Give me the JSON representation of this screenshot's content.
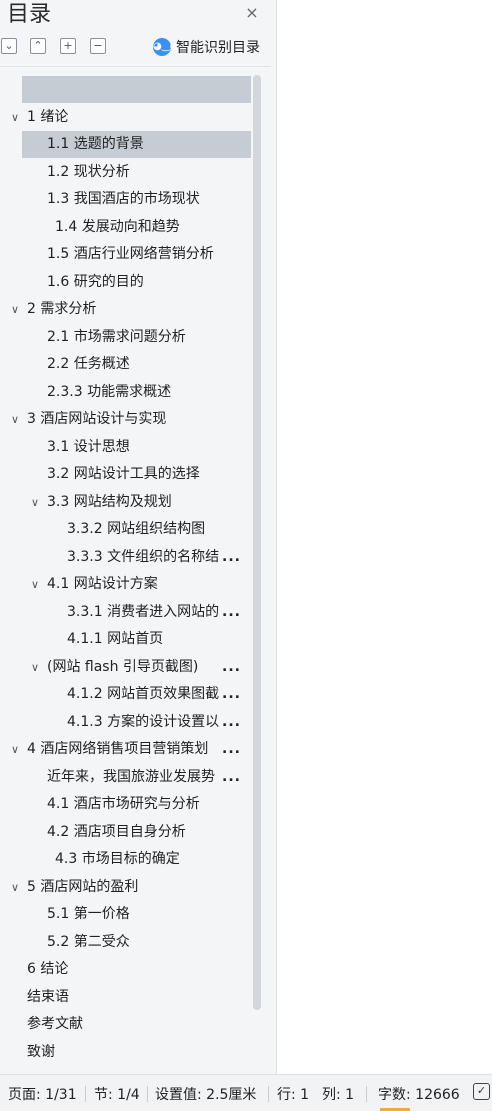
{
  "panel": {
    "title": "目录",
    "close_icon": "×",
    "smart_label": "智能识别目录"
  },
  "toolbar": {
    "collapse_all": "⌄",
    "expand_all": "⌃",
    "add": "+",
    "remove": "−"
  },
  "toc": [
    {
      "label": "",
      "chevron": "",
      "selected": true
    },
    {
      "label": "1  绪论",
      "chevron": "v",
      "selected": false
    },
    {
      "label": "1.1 选题的背景",
      "chevron": "",
      "selected": true
    },
    {
      "label": "1.2 现状分析",
      "chevron": "",
      "selected": false
    },
    {
      "label": "1.3 我国酒店的市场现状",
      "chevron": "",
      "selected": false
    },
    {
      "label": "1.4 发展动向和趋势",
      "chevron": "",
      "selected": false
    },
    {
      "label": "1.5 酒店行业网络营销分析",
      "chevron": "",
      "selected": false
    },
    {
      "label": "1.6 研究的目的",
      "chevron": "",
      "selected": false
    },
    {
      "label": "2  需求分析",
      "chevron": "v",
      "selected": false
    },
    {
      "label": "2.1 市场需求问题分析",
      "chevron": "",
      "selected": false
    },
    {
      "label": "2.2 任务概述",
      "chevron": "",
      "selected": false
    },
    {
      "label": "2.3.3 功能需求概述",
      "chevron": "",
      "selected": false
    },
    {
      "label": "3  酒店网站设计与实现",
      "chevron": "v",
      "selected": false
    },
    {
      "label": "3.1 设计思想",
      "chevron": "",
      "selected": false
    },
    {
      "label": "3.2 网站设计工具的选择",
      "chevron": "",
      "selected": false
    },
    {
      "label": "3.3 网站结构及规划",
      "chevron": "v",
      "selected": false
    },
    {
      "label": "3.3.2 网站组织结构图",
      "chevron": "",
      "selected": false
    },
    {
      "label": "3.3.3 文件组织的名称结",
      "chevron": "",
      "selected": false,
      "more": "..."
    },
    {
      "label": "4.1 网站设计方案",
      "chevron": "v",
      "selected": false
    },
    {
      "label": "3.3.1 消费者进入网站的",
      "chevron": "",
      "selected": false,
      "more": "..."
    },
    {
      "label": "4.1.1 网站首页",
      "chevron": "",
      "selected": false
    },
    {
      "label": "(网站 flash 引导页截图)",
      "chevron": "v",
      "selected": false,
      "more": "..."
    },
    {
      "label": "4.1.2 网站首页效果图截",
      "chevron": "",
      "selected": false,
      "more": "..."
    },
    {
      "label": "4.1.3 方案的设计设置以",
      "chevron": "",
      "selected": false,
      "more": "..."
    },
    {
      "label": "4  酒店网络销售项目营销策划",
      "chevron": "v",
      "selected": false,
      "more": "..."
    },
    {
      "label": "近年来，我国旅游业发展势",
      "chevron": "",
      "selected": false,
      "more": "..."
    },
    {
      "label": "4.1 酒店市场研究与分析",
      "chevron": "",
      "selected": false
    },
    {
      "label": "4.2 酒店项目自身分析",
      "chevron": "",
      "selected": false
    },
    {
      "label": "4.3 市场目标的确定",
      "chevron": "",
      "selected": false
    },
    {
      "label": "5  酒店网站的盈利",
      "chevron": "v",
      "selected": false
    },
    {
      "label": "5.1 第一价格",
      "chevron": "",
      "selected": false
    },
    {
      "label": "5.2 第二受众",
      "chevron": "",
      "selected": false
    },
    {
      "label": "6  结论",
      "chevron": "",
      "selected": false
    },
    {
      "label": "结束语",
      "chevron": "",
      "selected": false
    },
    {
      "label": "参考文献",
      "chevron": "",
      "selected": false
    },
    {
      "label": "致谢",
      "chevron": "",
      "selected": false
    }
  ],
  "status": {
    "page": "页面: 1/31",
    "section": "节: 1/4",
    "setting": "设置值: 2.5厘米",
    "row": "行: 1",
    "col": "列: 1",
    "words": "字数: 12666"
  }
}
